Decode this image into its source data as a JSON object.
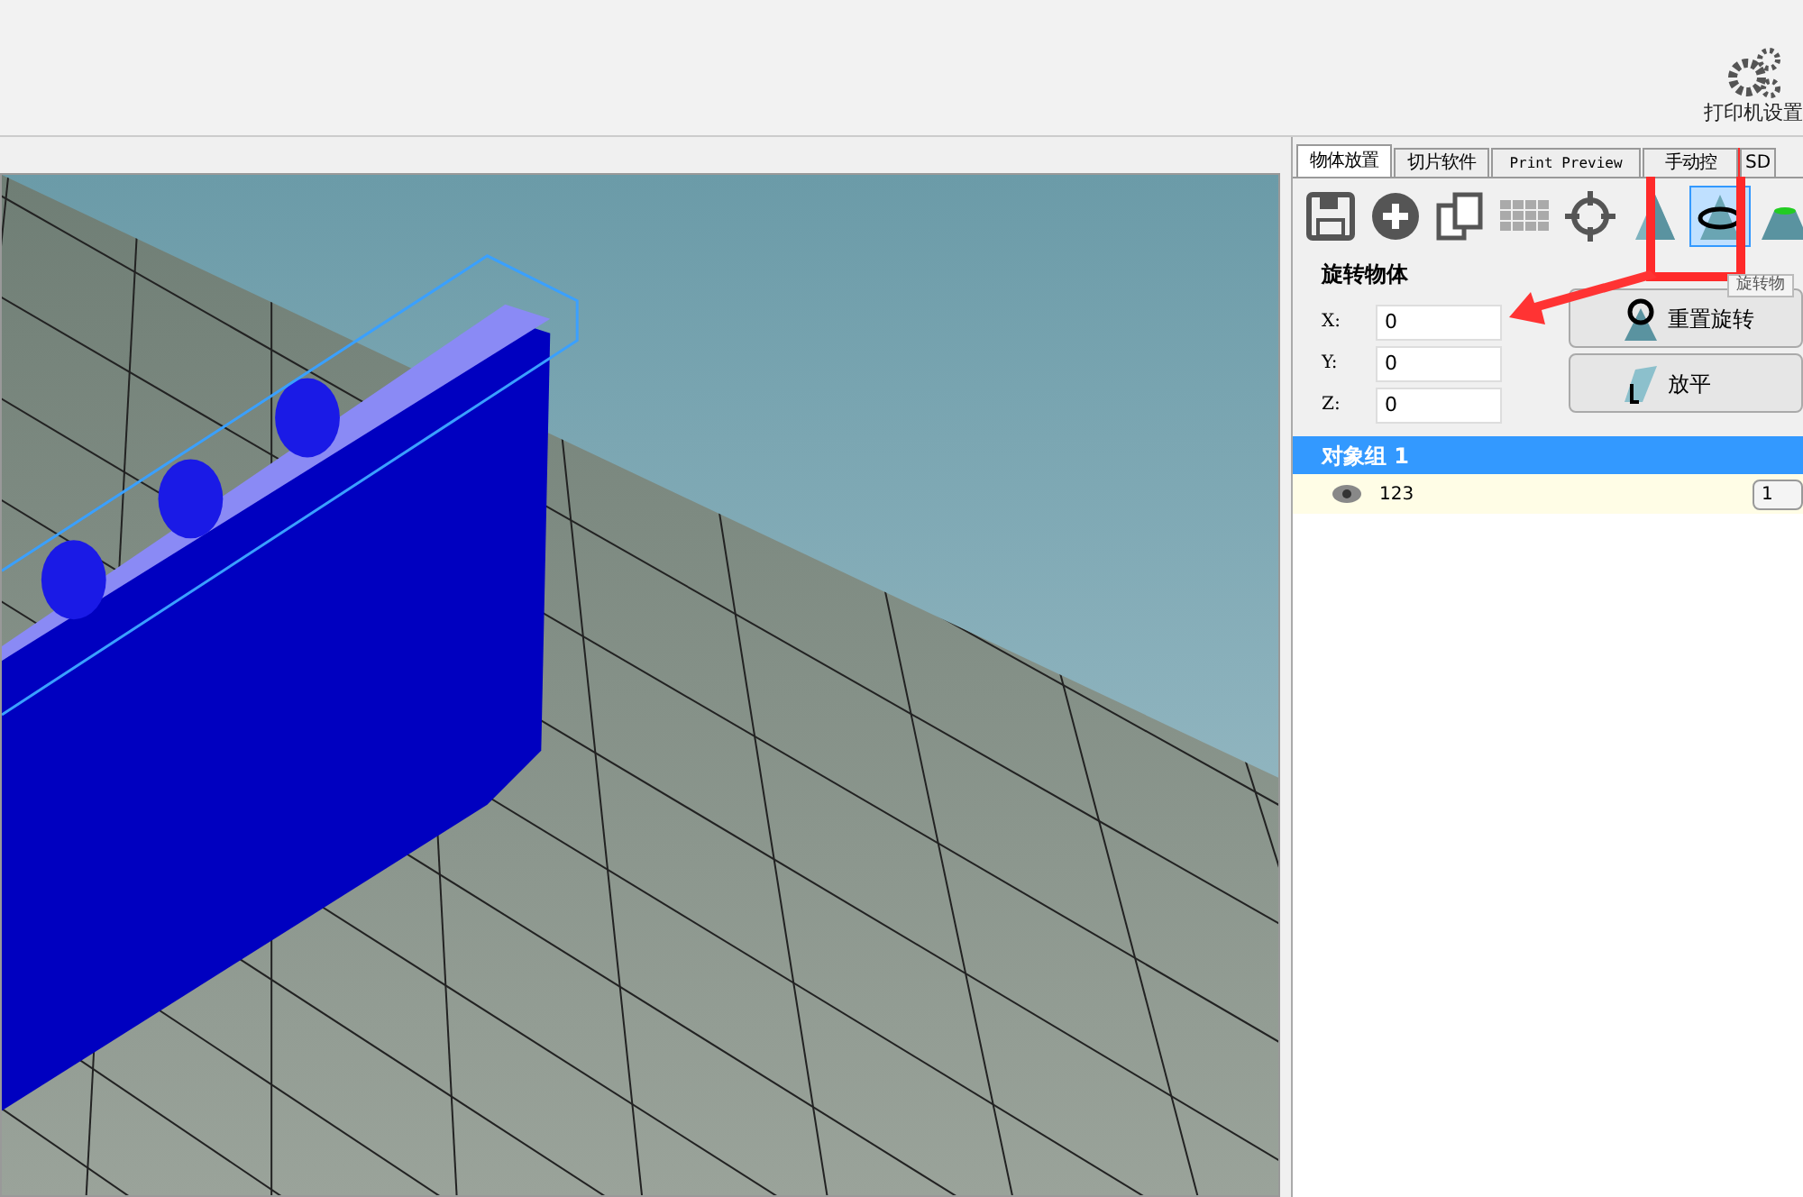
{
  "toolbar": {
    "printer_settings": "打印机设置"
  },
  "tabs": [
    {
      "label": "物体放置",
      "selected": true
    },
    {
      "label": "切片软件",
      "selected": false
    },
    {
      "label": "Print Preview",
      "selected": false
    },
    {
      "label": "手动控",
      "selected": false
    },
    {
      "label": "SD",
      "selected": false
    }
  ],
  "tools": [
    {
      "kind": "save",
      "selected": false
    },
    {
      "kind": "add",
      "selected": false
    },
    {
      "kind": "copy",
      "selected": false
    },
    {
      "kind": "grid",
      "selected": false
    },
    {
      "kind": "center",
      "selected": false
    },
    {
      "kind": "scale",
      "selected": false
    },
    {
      "kind": "rotate",
      "selected": true
    },
    {
      "kind": "cut",
      "selected": false
    }
  ],
  "rotate_panel": {
    "title": "旋转物体",
    "tooltip": "旋转物",
    "fields": [
      {
        "label": "X:",
        "value": "0"
      },
      {
        "label": "Y:",
        "value": "0"
      },
      {
        "label": "Z:",
        "value": "0"
      }
    ],
    "buttons": [
      {
        "kind": "reset",
        "label": "重置旋转"
      },
      {
        "kind": "flat",
        "label": "放平"
      }
    ]
  },
  "objects": {
    "group": "对象组 1",
    "items": [
      {
        "name": "123",
        "count": "1"
      }
    ]
  }
}
